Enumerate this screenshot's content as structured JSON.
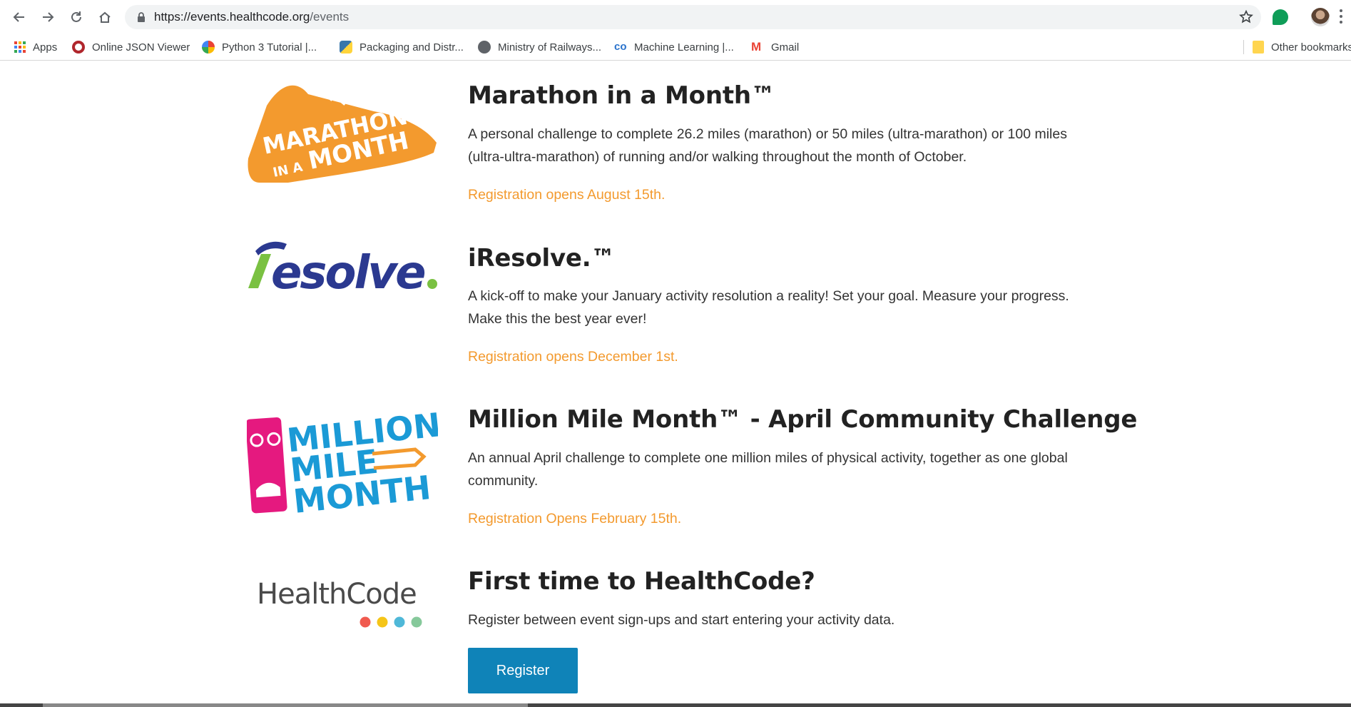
{
  "browser": {
    "url_host": "https://events.healthcode.org",
    "url_path": "/events"
  },
  "bookmarks": [
    {
      "label": "Apps",
      "icon": "apps-grid-icon"
    },
    {
      "label": "Online JSON Viewer",
      "icon": "json-viewer-icon"
    },
    {
      "label": "Python 3 Tutorial |...",
      "icon": "python-tutorial-icon"
    },
    {
      "label": "Packaging and Distr...",
      "icon": "python-icon"
    },
    {
      "label": "Ministry of Railways...",
      "icon": "globe-icon"
    },
    {
      "label": "Machine Learning |...",
      "icon": "coursera-icon"
    },
    {
      "label": "Gmail",
      "icon": "gmail-icon"
    },
    {
      "label": "Other bookmarks",
      "icon": "folder-icon"
    }
  ],
  "events": [
    {
      "logo_name": "marathon-in-a-month-logo",
      "title": "Marathon in a Month™",
      "description": "A personal challenge to complete 26.2 miles (marathon) or 50 miles (ultra-marathon) or 100 miles (ultra-ultra-marathon) of running and/or walking throughout the month of October.",
      "registration": "Registration opens August 15th."
    },
    {
      "logo_name": "iresolve-logo",
      "title": "iResolve.™",
      "description": "A kick-off to make your January activity resolution a reality! Set your goal. Measure your progress. Make this the best year ever!",
      "registration": "Registration opens December 1st."
    },
    {
      "logo_name": "million-mile-month-logo",
      "title": "Million Mile Month™ - April Community Challenge",
      "description": "An annual April challenge to complete one million miles of physical activity, together as one global community.",
      "registration": "Registration Opens February 15th."
    }
  ],
  "first_time": {
    "title": "First time to HealthCode?",
    "description": "Register between event sign-ups and start entering your activity data.",
    "register_label": "Register"
  },
  "logos": {
    "marathon_line1": "MARATHON",
    "marathon_line2a": "IN A",
    "marathon_line2b": "MONTH",
    "iresolve_text": "esolve",
    "million_line1": "MILLION",
    "million_line2": "MILE",
    "million_line3": "MONTH",
    "healthcode_text": "HealthCode"
  },
  "colors": {
    "accent_orange": "#f39a2e",
    "register_blue": "#0f83b8",
    "iresolve_blue": "#2b3990",
    "iresolve_green": "#7ac142",
    "million_pink": "#e5197f",
    "million_blue": "#1b9ad6"
  }
}
